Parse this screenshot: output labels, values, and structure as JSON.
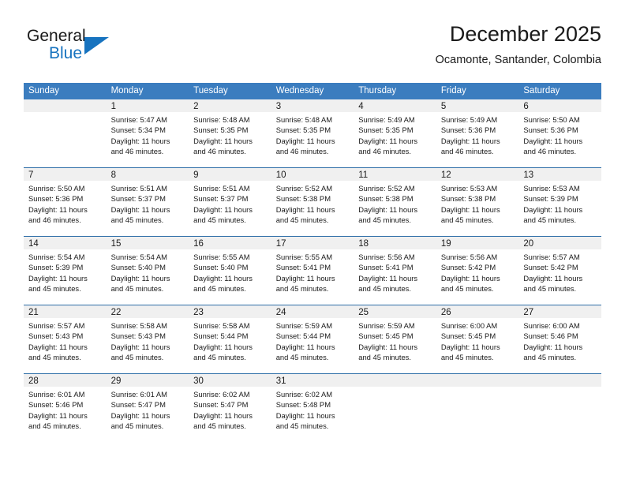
{
  "brand": {
    "name_top": "General",
    "name_bottom": "Blue",
    "triangle_color": "#1773bf",
    "text_color": "#1a1a1a"
  },
  "header": {
    "title": "December 2025",
    "subtitle": "Ocamonte, Santander, Colombia"
  },
  "theme": {
    "header_bg": "#3b7dbf",
    "header_text": "#ffffff",
    "row_divider": "#2f6fa8",
    "daynum_bg": "#f0f0f0",
    "body_text": "#1a1a1a"
  },
  "weekday_headers": [
    "Sunday",
    "Monday",
    "Tuesday",
    "Wednesday",
    "Thursday",
    "Friday",
    "Saturday"
  ],
  "weeks": [
    [
      {
        "day": "",
        "sunrise": "",
        "sunset": "",
        "daylight": ""
      },
      {
        "day": "1",
        "sunrise": "Sunrise: 5:47 AM",
        "sunset": "Sunset: 5:34 PM",
        "daylight": "Daylight: 11 hours and 46 minutes."
      },
      {
        "day": "2",
        "sunrise": "Sunrise: 5:48 AM",
        "sunset": "Sunset: 5:35 PM",
        "daylight": "Daylight: 11 hours and 46 minutes."
      },
      {
        "day": "3",
        "sunrise": "Sunrise: 5:48 AM",
        "sunset": "Sunset: 5:35 PM",
        "daylight": "Daylight: 11 hours and 46 minutes."
      },
      {
        "day": "4",
        "sunrise": "Sunrise: 5:49 AM",
        "sunset": "Sunset: 5:35 PM",
        "daylight": "Daylight: 11 hours and 46 minutes."
      },
      {
        "day": "5",
        "sunrise": "Sunrise: 5:49 AM",
        "sunset": "Sunset: 5:36 PM",
        "daylight": "Daylight: 11 hours and 46 minutes."
      },
      {
        "day": "6",
        "sunrise": "Sunrise: 5:50 AM",
        "sunset": "Sunset: 5:36 PM",
        "daylight": "Daylight: 11 hours and 46 minutes."
      }
    ],
    [
      {
        "day": "7",
        "sunrise": "Sunrise: 5:50 AM",
        "sunset": "Sunset: 5:36 PM",
        "daylight": "Daylight: 11 hours and 46 minutes."
      },
      {
        "day": "8",
        "sunrise": "Sunrise: 5:51 AM",
        "sunset": "Sunset: 5:37 PM",
        "daylight": "Daylight: 11 hours and 45 minutes."
      },
      {
        "day": "9",
        "sunrise": "Sunrise: 5:51 AM",
        "sunset": "Sunset: 5:37 PM",
        "daylight": "Daylight: 11 hours and 45 minutes."
      },
      {
        "day": "10",
        "sunrise": "Sunrise: 5:52 AM",
        "sunset": "Sunset: 5:38 PM",
        "daylight": "Daylight: 11 hours and 45 minutes."
      },
      {
        "day": "11",
        "sunrise": "Sunrise: 5:52 AM",
        "sunset": "Sunset: 5:38 PM",
        "daylight": "Daylight: 11 hours and 45 minutes."
      },
      {
        "day": "12",
        "sunrise": "Sunrise: 5:53 AM",
        "sunset": "Sunset: 5:38 PM",
        "daylight": "Daylight: 11 hours and 45 minutes."
      },
      {
        "day": "13",
        "sunrise": "Sunrise: 5:53 AM",
        "sunset": "Sunset: 5:39 PM",
        "daylight": "Daylight: 11 hours and 45 minutes."
      }
    ],
    [
      {
        "day": "14",
        "sunrise": "Sunrise: 5:54 AM",
        "sunset": "Sunset: 5:39 PM",
        "daylight": "Daylight: 11 hours and 45 minutes."
      },
      {
        "day": "15",
        "sunrise": "Sunrise: 5:54 AM",
        "sunset": "Sunset: 5:40 PM",
        "daylight": "Daylight: 11 hours and 45 minutes."
      },
      {
        "day": "16",
        "sunrise": "Sunrise: 5:55 AM",
        "sunset": "Sunset: 5:40 PM",
        "daylight": "Daylight: 11 hours and 45 minutes."
      },
      {
        "day": "17",
        "sunrise": "Sunrise: 5:55 AM",
        "sunset": "Sunset: 5:41 PM",
        "daylight": "Daylight: 11 hours and 45 minutes."
      },
      {
        "day": "18",
        "sunrise": "Sunrise: 5:56 AM",
        "sunset": "Sunset: 5:41 PM",
        "daylight": "Daylight: 11 hours and 45 minutes."
      },
      {
        "day": "19",
        "sunrise": "Sunrise: 5:56 AM",
        "sunset": "Sunset: 5:42 PM",
        "daylight": "Daylight: 11 hours and 45 minutes."
      },
      {
        "day": "20",
        "sunrise": "Sunrise: 5:57 AM",
        "sunset": "Sunset: 5:42 PM",
        "daylight": "Daylight: 11 hours and 45 minutes."
      }
    ],
    [
      {
        "day": "21",
        "sunrise": "Sunrise: 5:57 AM",
        "sunset": "Sunset: 5:43 PM",
        "daylight": "Daylight: 11 hours and 45 minutes."
      },
      {
        "day": "22",
        "sunrise": "Sunrise: 5:58 AM",
        "sunset": "Sunset: 5:43 PM",
        "daylight": "Daylight: 11 hours and 45 minutes."
      },
      {
        "day": "23",
        "sunrise": "Sunrise: 5:58 AM",
        "sunset": "Sunset: 5:44 PM",
        "daylight": "Daylight: 11 hours and 45 minutes."
      },
      {
        "day": "24",
        "sunrise": "Sunrise: 5:59 AM",
        "sunset": "Sunset: 5:44 PM",
        "daylight": "Daylight: 11 hours and 45 minutes."
      },
      {
        "day": "25",
        "sunrise": "Sunrise: 5:59 AM",
        "sunset": "Sunset: 5:45 PM",
        "daylight": "Daylight: 11 hours and 45 minutes."
      },
      {
        "day": "26",
        "sunrise": "Sunrise: 6:00 AM",
        "sunset": "Sunset: 5:45 PM",
        "daylight": "Daylight: 11 hours and 45 minutes."
      },
      {
        "day": "27",
        "sunrise": "Sunrise: 6:00 AM",
        "sunset": "Sunset: 5:46 PM",
        "daylight": "Daylight: 11 hours and 45 minutes."
      }
    ],
    [
      {
        "day": "28",
        "sunrise": "Sunrise: 6:01 AM",
        "sunset": "Sunset: 5:46 PM",
        "daylight": "Daylight: 11 hours and 45 minutes."
      },
      {
        "day": "29",
        "sunrise": "Sunrise: 6:01 AM",
        "sunset": "Sunset: 5:47 PM",
        "daylight": "Daylight: 11 hours and 45 minutes."
      },
      {
        "day": "30",
        "sunrise": "Sunrise: 6:02 AM",
        "sunset": "Sunset: 5:47 PM",
        "daylight": "Daylight: 11 hours and 45 minutes."
      },
      {
        "day": "31",
        "sunrise": "Sunrise: 6:02 AM",
        "sunset": "Sunset: 5:48 PM",
        "daylight": "Daylight: 11 hours and 45 minutes."
      },
      {
        "day": "",
        "sunrise": "",
        "sunset": "",
        "daylight": ""
      },
      {
        "day": "",
        "sunrise": "",
        "sunset": "",
        "daylight": ""
      },
      {
        "day": "",
        "sunrise": "",
        "sunset": "",
        "daylight": ""
      }
    ]
  ]
}
